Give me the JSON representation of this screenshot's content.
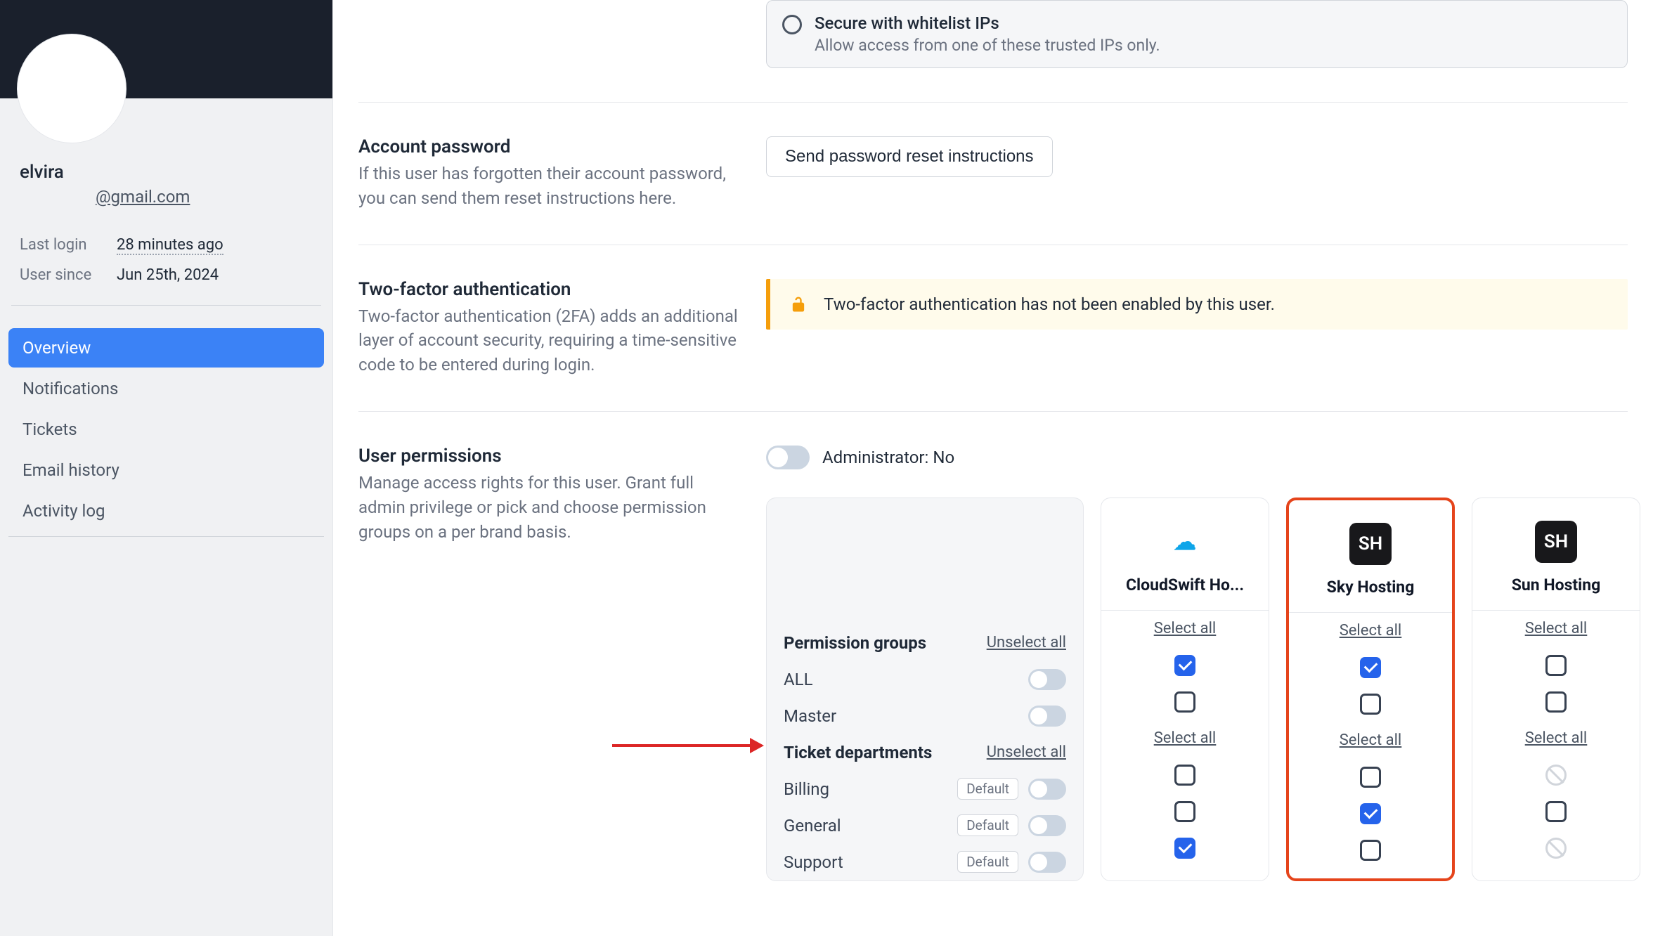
{
  "user": {
    "name": "elvira",
    "email": "@gmail.com",
    "last_login_label": "Last login",
    "last_login_value": "28 minutes ago",
    "since_label": "User since",
    "since_value": "Jun 25th, 2024"
  },
  "nav": {
    "overview": "Overview",
    "notifications": "Notifications",
    "tickets": "Tickets",
    "email_history": "Email history",
    "activity_log": "Activity log"
  },
  "ip": {
    "card_title": "Secure with whitelist IPs",
    "card_desc": "Allow access from one of these trusted IPs only."
  },
  "password": {
    "title": "Account password",
    "desc": "If this user has forgotten their account password, you can send them reset instructions here.",
    "button": "Send password reset instructions"
  },
  "tfa": {
    "title": "Two-factor authentication",
    "desc": "Two-factor authentication (2FA) adds an additional layer of account security, requiring a time-sensitive code to be entered during login.",
    "alert": "Two-factor authentication has not been enabled by this user."
  },
  "perms": {
    "title": "User permissions",
    "desc": "Manage access rights for this user. Grant full admin privilege or pick and choose permission groups on a per brand basis.",
    "admin_label": "Administrator: No",
    "groups_title": "Permission groups",
    "departments_title": "Ticket departments",
    "unselect_all": "Unselect all",
    "select_all": "Select all",
    "group_all": "ALL",
    "group_master": "Master",
    "dept_billing": "Billing",
    "dept_general": "General",
    "dept_support": "Support",
    "default_badge": "Default"
  },
  "brands": {
    "cloudswift": {
      "name": "CloudSwift Ho...",
      "logo_text": "☁"
    },
    "sky": {
      "name": "Sky Hosting",
      "logo_text": "SH"
    },
    "sun": {
      "name": "Sun Hosting",
      "logo_text": "SH"
    }
  },
  "matrix": {
    "cloudswift": {
      "all": true,
      "master": false,
      "billing": "unchecked",
      "general": "unchecked",
      "support": "checked"
    },
    "sky": {
      "all": true,
      "master": false,
      "billing": "unchecked",
      "general": "checked",
      "support": "unchecked"
    },
    "sun": {
      "all": false,
      "master": false,
      "billing": "na",
      "general": "unchecked",
      "support": "na"
    }
  }
}
